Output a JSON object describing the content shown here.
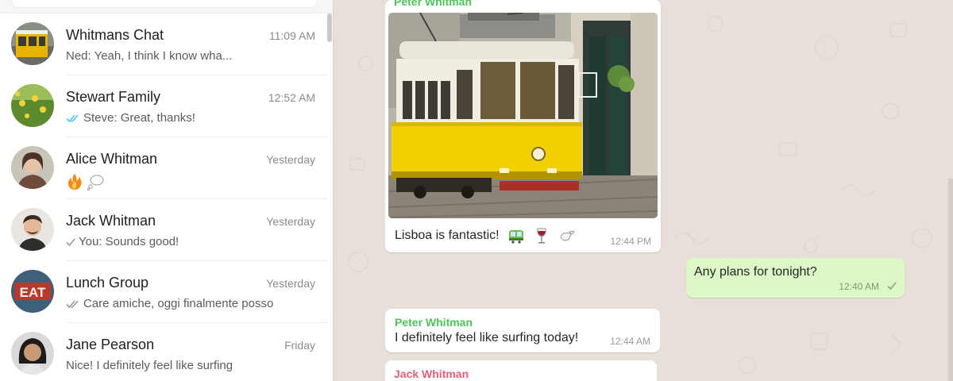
{
  "sidebar": {
    "chats": [
      {
        "name": "Whitmans Chat",
        "time": "11:09 AM",
        "preview": "Ned: Yeah, I think I know wha...",
        "receipt": "none",
        "avatar_icon": "tram-avatar-icon"
      },
      {
        "name": "Stewart Family",
        "time": "12:52 AM",
        "preview": "Steve: Great, thanks!",
        "receipt": "read",
        "avatar_icon": "flowers-avatar-icon"
      },
      {
        "name": "Alice Whitman",
        "time": "Yesterday",
        "preview": "",
        "receipt": "none",
        "avatar_icon": "woman-avatar-icon",
        "preview_icons": [
          "fire-emoji-icon",
          "thought-bubble-emoji-icon"
        ]
      },
      {
        "name": "Jack Whitman",
        "time": "Yesterday",
        "preview": "You: Sounds good!",
        "receipt": "sent",
        "avatar_icon": "man-avatar-icon"
      },
      {
        "name": "Lunch Group",
        "time": "Yesterday",
        "preview": "Care amiche, oggi finalmente posso",
        "receipt": "delivered",
        "avatar_icon": "eat-sign-avatar-icon"
      },
      {
        "name": "Jane Pearson",
        "time": "Friday",
        "preview": "Nice! I definitely feel like surfing",
        "receipt": "none",
        "avatar_icon": "woman2-avatar-icon"
      }
    ]
  },
  "conversation": {
    "photo_message": {
      "sender": "Peter Whitman",
      "caption": "Lisboa is fantastic!",
      "caption_icons": [
        "tram-emoji-icon",
        "wine-glass-emoji-icon",
        "dove-emoji-icon"
      ],
      "time": "12:44 PM",
      "image_icon": "yellow-tram-photo"
    },
    "outgoing_message": {
      "text": "Any plans for tonight?",
      "time": "12:40 AM",
      "receipt": "sent"
    },
    "text_message": {
      "sender": "Peter Whitman",
      "text": "I definitely feel like surfing today!",
      "time": "12:44 AM"
    },
    "partial_message": {
      "sender": "Jack Whitman"
    }
  },
  "colors": {
    "sender_green": "#4fc35b",
    "sender_pink": "#e0607e",
    "outgoing_bubble": "#dcf8c6",
    "read_tick": "#4fc3f7",
    "chat_background": "#e6e0d8"
  }
}
